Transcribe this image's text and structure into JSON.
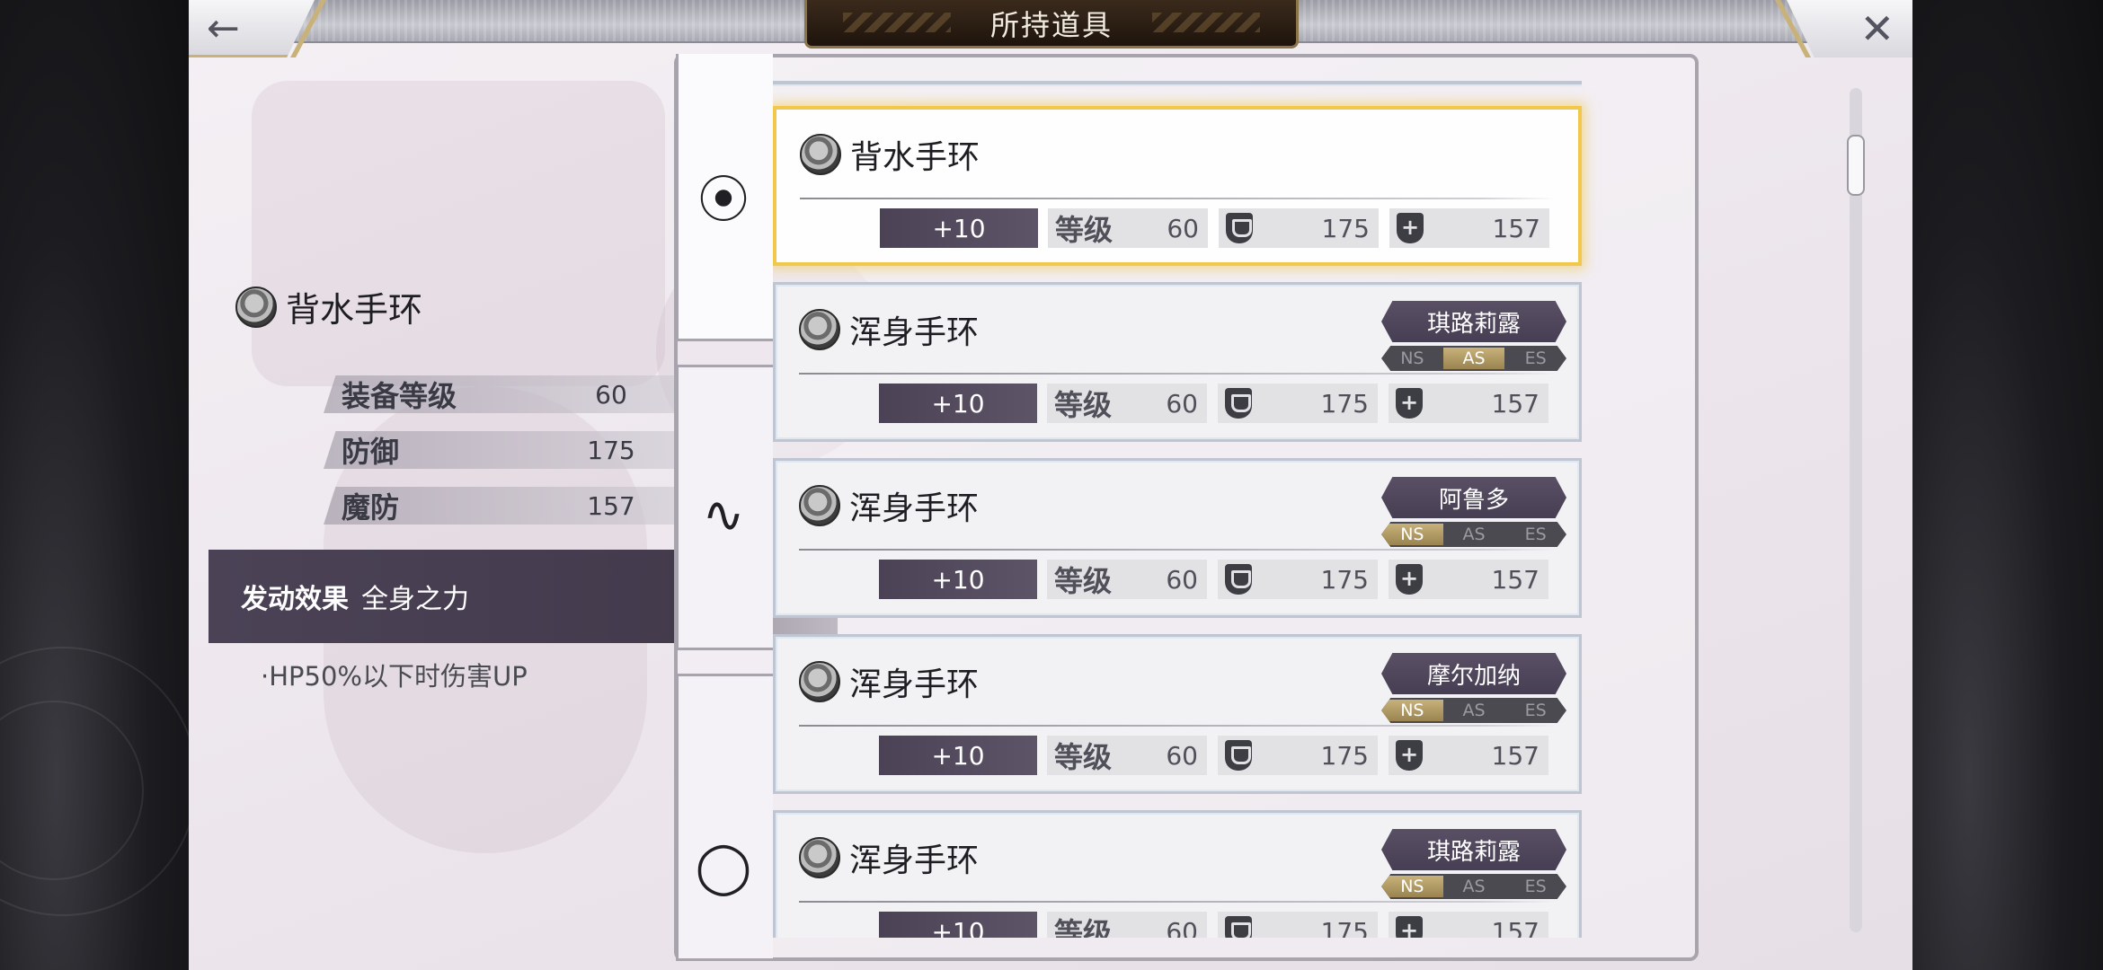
{
  "window": {
    "title": "所持道具"
  },
  "nav": {
    "back_icon": "back-arrow-icon",
    "close_icon": "close-icon",
    "back_glyph": "←",
    "close_glyph": "✕"
  },
  "detail": {
    "name": "背水手环",
    "stats": [
      {
        "label": "装备等级",
        "value": "60"
      },
      {
        "label": "防御",
        "value": "175"
      },
      {
        "label": "魔防",
        "value": "157"
      }
    ],
    "effect_label": "发动效果",
    "effect_name": "全身之力",
    "effect_desc": "·HP50%以下时伤害UP"
  },
  "tabs": [
    {
      "name": "bracelet",
      "glyph": "⦿",
      "active": true
    },
    {
      "name": "accessory",
      "glyph": "∿",
      "active": false
    },
    {
      "name": "ring",
      "glyph": "◯",
      "active": false
    }
  ],
  "list": {
    "level_label": "等级",
    "items": [
      {
        "name": "背水手环",
        "plus": "+10",
        "level": "60",
        "def": "175",
        "mdef": "157",
        "selected": true,
        "owner": "",
        "modes": []
      },
      {
        "name": "浑身手环",
        "plus": "+10",
        "level": "60",
        "def": "175",
        "mdef": "157",
        "selected": false,
        "owner": "琪路莉露",
        "modes": [
          {
            "t": "NS",
            "on": false
          },
          {
            "t": "AS",
            "on": true
          },
          {
            "t": "ES",
            "on": false
          }
        ]
      },
      {
        "name": "浑身手环",
        "plus": "+10",
        "level": "60",
        "def": "175",
        "mdef": "157",
        "selected": false,
        "owner": "阿鲁多",
        "modes": [
          {
            "t": "NS",
            "on": true
          },
          {
            "t": "AS",
            "on": false
          },
          {
            "t": "ES",
            "on": false
          }
        ]
      },
      {
        "name": "浑身手环",
        "plus": "+10",
        "level": "60",
        "def": "175",
        "mdef": "157",
        "selected": false,
        "owner": "摩尔加纳",
        "modes": [
          {
            "t": "NS",
            "on": true
          },
          {
            "t": "AS",
            "on": false
          },
          {
            "t": "ES",
            "on": false
          }
        ]
      },
      {
        "name": "浑身手环",
        "plus": "+10",
        "level": "60",
        "def": "175",
        "mdef": "157",
        "selected": false,
        "owner": "琪路莉露",
        "modes": [
          {
            "t": "NS",
            "on": true
          },
          {
            "t": "AS",
            "on": false
          },
          {
            "t": "ES",
            "on": false
          }
        ]
      }
    ]
  },
  "colors": {
    "accent_gold": "#f2c84c",
    "plate_dark": "#4b4256"
  }
}
